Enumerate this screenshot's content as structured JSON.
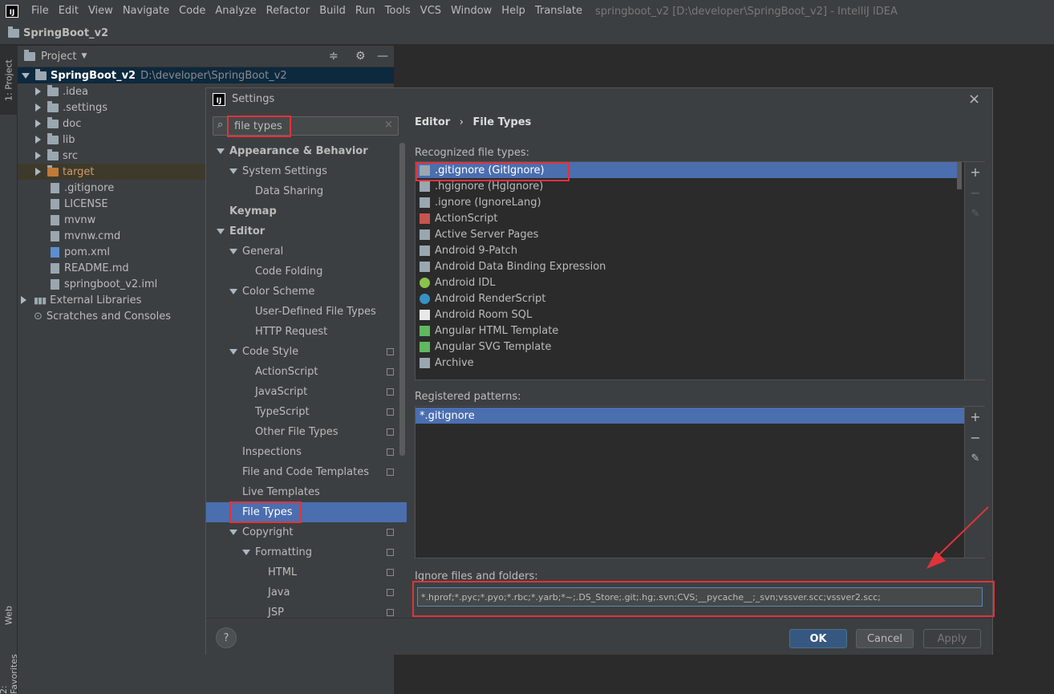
{
  "menubar": {
    "logo": "IJ",
    "items": [
      "File",
      "Edit",
      "View",
      "Navigate",
      "Code",
      "Analyze",
      "Refactor",
      "Build",
      "Run",
      "Tools",
      "VCS",
      "Window",
      "Help",
      "Translate"
    ],
    "window_title": "springboot_v2 [D:\\developer\\SpringBoot_v2] - IntelliJ IDEA"
  },
  "navbar": {
    "project": "SpringBoot_v2"
  },
  "leftstrip": {
    "project_tab": "1: Project",
    "web_tab": "Web",
    "favorites_tab": "2: Favorites"
  },
  "project": {
    "header": "Project",
    "root": {
      "name": "SpringBoot_v2",
      "path": "D:\\developer\\SpringBoot_v2"
    },
    "items": [
      {
        "label": ".idea",
        "type": "folder",
        "expandable": true
      },
      {
        "label": ".settings",
        "type": "folder",
        "expandable": true
      },
      {
        "label": "doc",
        "type": "folder",
        "expandable": true
      },
      {
        "label": "lib",
        "type": "folder",
        "expandable": true
      },
      {
        "label": "src",
        "type": "folder",
        "expandable": true
      },
      {
        "label": "target",
        "type": "folder-excluded",
        "expandable": true
      },
      {
        "label": ".gitignore",
        "type": "file",
        "expandable": false
      },
      {
        "label": "LICENSE",
        "type": "file",
        "expandable": false
      },
      {
        "label": "mvnw",
        "type": "file",
        "expandable": false
      },
      {
        "label": "mvnw.cmd",
        "type": "file",
        "expandable": false
      },
      {
        "label": "pom.xml",
        "type": "maven",
        "expandable": false
      },
      {
        "label": "README.md",
        "type": "md",
        "expandable": false
      },
      {
        "label": "springboot_v2.iml",
        "type": "file",
        "expandable": false
      }
    ],
    "external_libraries": "External Libraries",
    "scratches": "Scratches and Consoles"
  },
  "dialog": {
    "title": "Settings",
    "search_value": "file types",
    "breadcrumb": {
      "parent": "Editor",
      "separator": "›",
      "current": "File Types"
    },
    "nav": [
      {
        "label": "Appearance & Behavior",
        "level": 0,
        "bold": true,
        "expand": "down",
        "copy": false
      },
      {
        "label": "System Settings",
        "level": 1,
        "bold": false,
        "expand": "down",
        "copy": false
      },
      {
        "label": "Data Sharing",
        "level": 2,
        "bold": false,
        "expand": "",
        "copy": false
      },
      {
        "label": "Keymap",
        "level": 0,
        "bold": true,
        "expand": "",
        "copy": false
      },
      {
        "label": "Editor",
        "level": 0,
        "bold": true,
        "expand": "down",
        "copy": false
      },
      {
        "label": "General",
        "level": 1,
        "bold": false,
        "expand": "down",
        "copy": false
      },
      {
        "label": "Code Folding",
        "level": 2,
        "bold": false,
        "expand": "",
        "copy": false
      },
      {
        "label": "Color Scheme",
        "level": 1,
        "bold": false,
        "expand": "down",
        "copy": false
      },
      {
        "label": "User-Defined File Types",
        "level": 2,
        "bold": false,
        "expand": "",
        "copy": false
      },
      {
        "label": "HTTP Request",
        "level": 2,
        "bold": false,
        "expand": "",
        "copy": false
      },
      {
        "label": "Code Style",
        "level": 1,
        "bold": false,
        "expand": "down",
        "copy": true
      },
      {
        "label": "ActionScript",
        "level": 2,
        "bold": false,
        "expand": "",
        "copy": true
      },
      {
        "label": "JavaScript",
        "level": 2,
        "bold": false,
        "expand": "",
        "copy": true
      },
      {
        "label": "TypeScript",
        "level": 2,
        "bold": false,
        "expand": "",
        "copy": true
      },
      {
        "label": "Other File Types",
        "level": 2,
        "bold": false,
        "expand": "",
        "copy": true
      },
      {
        "label": "Inspections",
        "level": 1,
        "bold": false,
        "expand": "",
        "copy": true
      },
      {
        "label": "File and Code Templates",
        "level": 1,
        "bold": false,
        "expand": "",
        "copy": true
      },
      {
        "label": "Live Templates",
        "level": 1,
        "bold": false,
        "expand": "",
        "copy": false
      },
      {
        "label": "File Types",
        "level": 1,
        "bold": false,
        "expand": "",
        "copy": false,
        "selected": true
      },
      {
        "label": "Copyright",
        "level": 1,
        "bold": false,
        "expand": "down",
        "copy": true
      },
      {
        "label": "Formatting",
        "level": 2,
        "bold": false,
        "expand": "down",
        "copy": true
      },
      {
        "label": "HTML",
        "level": 3,
        "bold": false,
        "expand": "",
        "copy": true
      },
      {
        "label": "Java",
        "level": 3,
        "bold": false,
        "expand": "",
        "copy": true
      },
      {
        "label": "JSP",
        "level": 3,
        "bold": false,
        "expand": "",
        "copy": true
      }
    ],
    "recognized_label": "Recognized file types:",
    "recognized": [
      {
        "label": ".gitignore (GitIgnore)",
        "icon": "gitignore-icon",
        "selected": true
      },
      {
        "label": ".hgignore (HgIgnore)",
        "icon": "hgignore-icon"
      },
      {
        "label": ".ignore (IgnoreLang)",
        "icon": "ignore-icon"
      },
      {
        "label": "ActionScript",
        "icon": "actionscript-icon"
      },
      {
        "label": "Active Server Pages",
        "icon": "asp-icon"
      },
      {
        "label": "Android 9-Patch",
        "icon": "folder-icon"
      },
      {
        "label": "Android Data Binding Expression",
        "icon": "databinding-icon"
      },
      {
        "label": "Android IDL",
        "icon": "android-icon"
      },
      {
        "label": "Android RenderScript",
        "icon": "renderscript-icon"
      },
      {
        "label": "Android Room SQL",
        "icon": "room-sql-icon"
      },
      {
        "label": "Angular HTML Template",
        "icon": "angular-html-icon"
      },
      {
        "label": "Angular SVG Template",
        "icon": "angular-svg-icon"
      },
      {
        "label": "Archive",
        "icon": "archive-icon"
      }
    ],
    "patterns_label": "Registered patterns:",
    "patterns": [
      "*.gitignore"
    ],
    "ignore_label": "Ignore files and folders:",
    "ignore_value": "*.hprof;*.pyc;*.pyo;*.rbc;*.yarb;*~;.DS_Store;.git;.hg;.svn;CVS;__pycache__;_svn;vssver.scc;vssver2.scc;",
    "buttons": {
      "help": "?",
      "ok": "OK",
      "cancel": "Cancel",
      "apply": "Apply"
    }
  },
  "colors": {
    "selection": "#4b6eaf",
    "annotation_red": "#e0333a",
    "background": "#3c3f41"
  }
}
